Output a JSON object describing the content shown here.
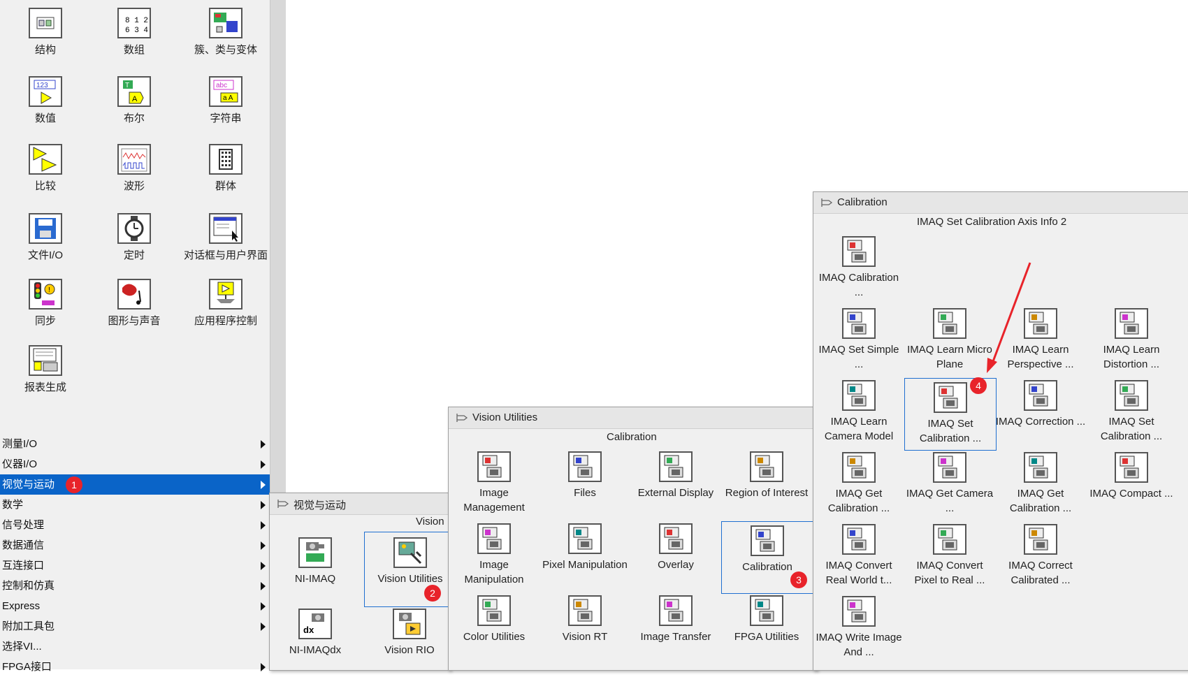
{
  "palette": [
    {
      "label": "结构",
      "icon": "structure-icon"
    },
    {
      "label": "数组",
      "icon": "array-icon"
    },
    {
      "label": "簇、类与变体",
      "icon": "cluster-icon"
    },
    {
      "label": "数值",
      "icon": "numeric-icon"
    },
    {
      "label": "布尔",
      "icon": "boolean-icon"
    },
    {
      "label": "字符串",
      "icon": "string-icon"
    },
    {
      "label": "比较",
      "icon": "comparison-icon"
    },
    {
      "label": "波形",
      "icon": "waveform-icon"
    },
    {
      "label": "群体",
      "icon": "cluster-group-icon"
    },
    {
      "label": "文件I/O",
      "icon": "file-io-icon"
    },
    {
      "label": "定时",
      "icon": "timing-icon"
    },
    {
      "label": "对话框与用户界面",
      "icon": "dialog-ui-icon"
    },
    {
      "label": "同步",
      "icon": "sync-icon"
    },
    {
      "label": "图形与声音",
      "icon": "graphics-sound-icon"
    },
    {
      "label": "应用程序控制",
      "icon": "app-control-icon"
    },
    {
      "label": "报表生成",
      "icon": "report-icon"
    }
  ],
  "menu": [
    {
      "label": "测量I/O",
      "selected": false
    },
    {
      "label": "仪器I/O",
      "selected": false
    },
    {
      "label": "视觉与运动",
      "selected": true
    },
    {
      "label": "数学",
      "selected": false
    },
    {
      "label": "信号处理",
      "selected": false
    },
    {
      "label": "数据通信",
      "selected": false
    },
    {
      "label": "互连接口",
      "selected": false
    },
    {
      "label": "控制和仿真",
      "selected": false
    },
    {
      "label": "Express",
      "selected": false
    },
    {
      "label": "附加工具包",
      "selected": false
    },
    {
      "label": "选择VI...",
      "selected": false
    },
    {
      "label": "FPGA接口",
      "selected": false
    }
  ],
  "badges": [
    "1",
    "2",
    "3",
    "4"
  ],
  "vision_motion": {
    "title": "视觉与运动",
    "subtitle": "Vision",
    "items": [
      {
        "label": "NI-IMAQ",
        "icon": "ni-imaq-icon"
      },
      {
        "label": "Vision Utilities",
        "icon": "vision-utilities-icon"
      },
      {
        "label": "NI-IMAQdx",
        "icon": "ni-imaqdx-icon"
      },
      {
        "label": "Vision RIO",
        "icon": "vision-rio-icon"
      }
    ]
  },
  "vision_utilities": {
    "title": "Vision Utilities",
    "subtitle": "Calibration",
    "items": [
      {
        "label": "Image Management",
        "icon": "image-management-icon"
      },
      {
        "label": "Files",
        "icon": "files-icon"
      },
      {
        "label": "External Display",
        "icon": "external-display-icon"
      },
      {
        "label": "Region of Interest",
        "icon": "roi-icon"
      },
      {
        "label": "Image Manipulation",
        "icon": "image-manipulation-icon"
      },
      {
        "label": "Pixel Manipulation",
        "icon": "pixel-manipulation-icon"
      },
      {
        "label": "Overlay",
        "icon": "overlay-icon"
      },
      {
        "label": "Calibration",
        "icon": "calibration-icon"
      },
      {
        "label": "Color Utilities",
        "icon": "color-utilities-icon"
      },
      {
        "label": "Vision RT",
        "icon": "vision-rt-icon"
      },
      {
        "label": "Image Transfer",
        "icon": "image-transfer-icon"
      },
      {
        "label": "FPGA Utilities",
        "icon": "fpga-utilities-icon"
      }
    ]
  },
  "calibration": {
    "title": "Calibration",
    "subtitle": "IMAQ Set Calibration Axis Info 2",
    "items": [
      {
        "label": "IMAQ Calibration ...",
        "icon": "imaq-calibration-icon"
      },
      {
        "label": "IMAQ Set Simple ...",
        "icon": "imaq-set-simple-icon"
      },
      {
        "label": "IMAQ Learn Micro Plane",
        "icon": "imaq-learn-micro-plane-icon"
      },
      {
        "label": "IMAQ Learn Perspective ...",
        "icon": "imaq-learn-perspective-icon"
      },
      {
        "label": "IMAQ Learn Distortion ...",
        "icon": "imaq-learn-distortion-icon"
      },
      {
        "label": "IMAQ Learn Camera Model",
        "icon": "imaq-learn-camera-model-icon"
      },
      {
        "label": "IMAQ Set Calibration ...",
        "icon": "imaq-set-calibration-axis-icon"
      },
      {
        "label": "IMAQ Correction ...",
        "icon": "imaq-correction-icon"
      },
      {
        "label": "IMAQ Set Calibration ...",
        "icon": "imaq-set-calibration-icon"
      },
      {
        "label": "IMAQ Get Calibration ...",
        "icon": "imaq-get-calibration-icon"
      },
      {
        "label": "IMAQ Get Camera ...",
        "icon": "imaq-get-camera-icon"
      },
      {
        "label": "IMAQ Get Calibration ...",
        "icon": "imaq-get-calibration-info-icon"
      },
      {
        "label": "IMAQ Compact ...",
        "icon": "imaq-compact-icon"
      },
      {
        "label": "IMAQ Convert Real World t...",
        "icon": "imaq-convert-real-world-icon"
      },
      {
        "label": "IMAQ Convert Pixel to Real ...",
        "icon": "imaq-convert-pixel-icon"
      },
      {
        "label": "IMAQ Correct Calibrated ...",
        "icon": "imaq-correct-calibrated-icon"
      },
      {
        "label": "IMAQ Write Image And ...",
        "icon": "imaq-write-image-icon"
      }
    ]
  },
  "colors": {
    "selection": "#0a64c8",
    "badge": "#e8232a",
    "highlight_border": "#1f6fd0",
    "arrow": "#e8232a"
  }
}
